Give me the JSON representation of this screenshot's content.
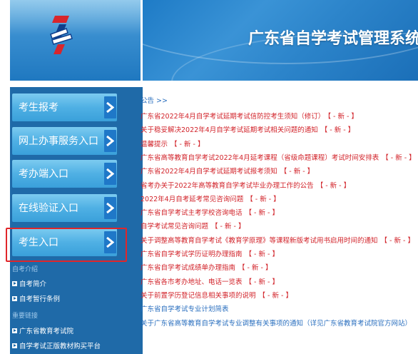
{
  "header": {
    "site_title": "广东省自学考试管理系统"
  },
  "sidebar": {
    "buttons": [
      {
        "label": "考生报考"
      },
      {
        "label": "网上办事服务入口"
      },
      {
        "label": "考办端入口"
      },
      {
        "label": "在线验证入口"
      },
      {
        "label": "考生入口"
      }
    ],
    "section_intro": "自考介绍",
    "intro_links": [
      "自考简介",
      "自考暂行条例"
    ],
    "section_links": "重要链接",
    "important_links": [
      "广东省教育考试院",
      "自学考试正版教材购买平台"
    ]
  },
  "notices": {
    "heading": "公告 >>",
    "new_tag": "【 - 新 - 】",
    "items": [
      {
        "text": "广东省2022年4月自学考试延期考试信防控考生须知（修订）",
        "new": true,
        "color": "red"
      },
      {
        "text": "关于稳妥解决2022年4月自学考试延期考试相关问题的通知",
        "new": true,
        "color": "red"
      },
      {
        "text": "温馨提示",
        "new": true,
        "color": "red"
      },
      {
        "text": "广东省高等教育自学考试2022年4月延考课程（省级命题课程）考试时间安排表",
        "new": true,
        "color": "red"
      },
      {
        "text": "广东省2022年4月自学考试延期考试报考须知",
        "new": true,
        "color": "red"
      },
      {
        "text": "省考办关于2022年高等教育自学考试毕业办理工作的公告",
        "new": true,
        "color": "red"
      },
      {
        "text": "2022年4月自考延考常见咨询问题",
        "new": true,
        "color": "red"
      },
      {
        "text": "广东省自学考试主考学校咨询电话",
        "new": true,
        "color": "red"
      },
      {
        "text": "自学考试常见咨询问题",
        "new": true,
        "color": "red"
      },
      {
        "text": "关于调整高等教育自学考试《教育学原理》等课程新版考试用书启用时间的通知",
        "new": true,
        "color": "red"
      },
      {
        "text": "广东省自学考试学历证明办理指南",
        "new": true,
        "color": "red"
      },
      {
        "text": "广东省自学考试成绩单办理指南",
        "new": true,
        "color": "red"
      },
      {
        "text": "广东省各市考办地址、电话一览表",
        "new": true,
        "color": "red"
      },
      {
        "text": "关于前置学历登记信息相关事项的说明",
        "new": true,
        "color": "red"
      },
      {
        "text": "广东省自学考试专业计划简表",
        "new": false,
        "color": "blue"
      },
      {
        "text": "关于广东省高等教育自学考试专业调整有关事项的通知（详见广东省教育考试院官方网站）",
        "new": false,
        "color": "blue"
      }
    ]
  }
}
